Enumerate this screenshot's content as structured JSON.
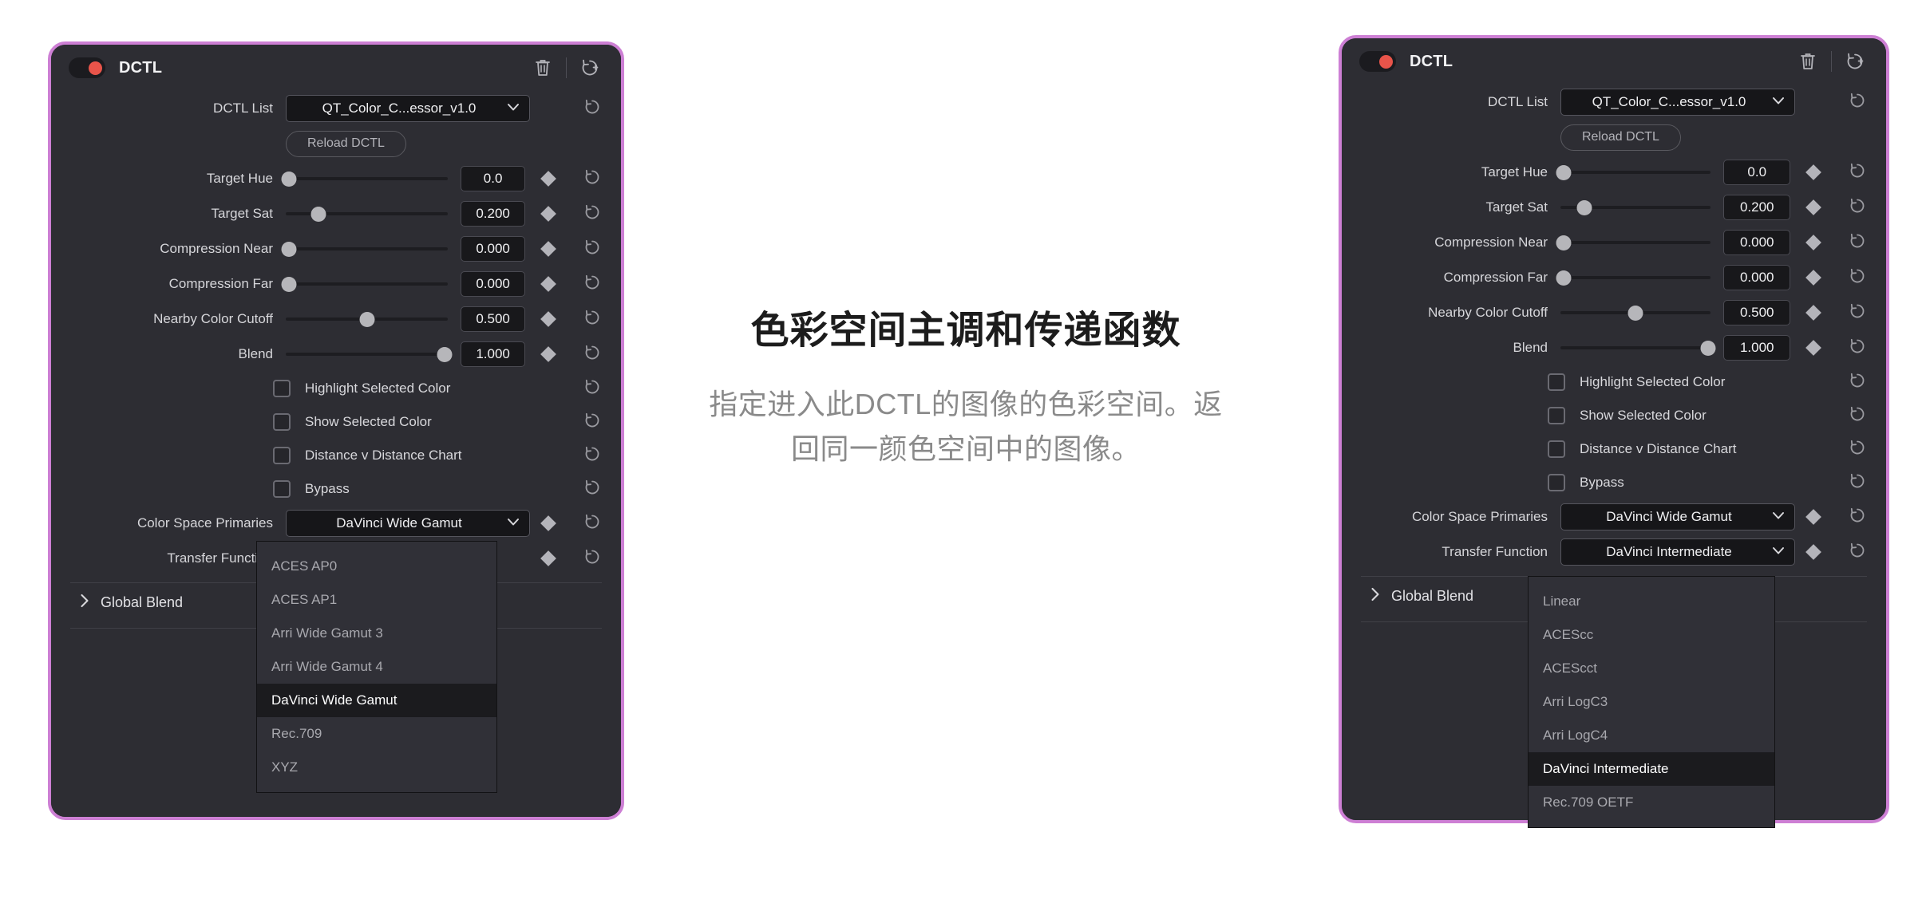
{
  "colors": {
    "panel_border": "#cd7fd4",
    "panel_bg": "#2d2d33",
    "toggle_dot": "#e8544a",
    "menu_bg": "#303037",
    "menu_selected_bg": "#1b1b1e",
    "value_bg": "#18181b",
    "title_text": "#1c1c1c",
    "desc_text": "#8a8a8a"
  },
  "center": {
    "title": "色彩空间主调和传递函数",
    "description": "指定进入此DCTL的图像的色彩空间。返回同一颜色空间中的图像。"
  },
  "panel_left": {
    "header": {
      "title": "DCTL",
      "toggle_state": "on",
      "delete_icon": "trash-icon",
      "reset_all_icon": "reset-add-icon"
    },
    "dctl_list": {
      "label": "DCTL List",
      "value": "QT_Color_C...essor_v1.0",
      "caret_icon": "chevron-down-icon",
      "reset_icon": "reset-icon"
    },
    "reload_button": "Reload DCTL",
    "sliders": [
      {
        "label": "Target Hue",
        "value": "0.0",
        "pos": 2,
        "kf": true,
        "reset_icon": "reset-icon"
      },
      {
        "label": "Target Sat",
        "value": "0.200",
        "pos": 20,
        "kf": true,
        "reset_icon": "reset-icon"
      },
      {
        "label": "Compression Near",
        "value": "0.000",
        "pos": 2,
        "kf": true,
        "reset_icon": "reset-icon"
      },
      {
        "label": "Compression Far",
        "value": "0.000",
        "pos": 2,
        "kf": true,
        "reset_icon": "reset-icon"
      },
      {
        "label": "Nearby Color Cutoff",
        "value": "0.500",
        "pos": 50,
        "kf": true,
        "reset_icon": "reset-icon"
      },
      {
        "label": "Blend",
        "value": "1.000",
        "pos": 98,
        "kf": true,
        "reset_icon": "reset-icon"
      }
    ],
    "checkboxes": [
      {
        "label": "Highlight Selected Color",
        "checked": false,
        "reset_icon": "reset-icon"
      },
      {
        "label": "Show Selected Color",
        "checked": false,
        "reset_icon": "reset-icon"
      },
      {
        "label": "Distance v Distance Chart",
        "checked": false,
        "reset_icon": "reset-icon"
      },
      {
        "label": "Bypass",
        "checked": false,
        "reset_icon": "reset-icon"
      }
    ],
    "color_space_primaries": {
      "label": "Color Space Primaries",
      "value": "DaVinci Wide Gamut",
      "caret_icon": "chevron-down-icon",
      "kf": true,
      "reset_icon": "reset-icon"
    },
    "transfer_function": {
      "label": "Transfer Function",
      "value": "",
      "kf": true,
      "reset_icon": "reset-icon"
    },
    "global_blend": {
      "label": "Global Blend",
      "arrow_icon": "chevron-right-icon"
    },
    "open_menu": {
      "name": "color-space-primaries-menu",
      "items": [
        {
          "label": "ACES AP0",
          "selected": false
        },
        {
          "label": "ACES AP1",
          "selected": false
        },
        {
          "label": "Arri Wide Gamut 3",
          "selected": false
        },
        {
          "label": "Arri Wide Gamut 4",
          "selected": false
        },
        {
          "label": "DaVinci Wide Gamut",
          "selected": true
        },
        {
          "label": "Rec.709",
          "selected": false
        },
        {
          "label": "XYZ",
          "selected": false
        }
      ]
    }
  },
  "panel_right": {
    "header": {
      "title": "DCTL",
      "toggle_state": "on",
      "delete_icon": "trash-icon",
      "reset_all_icon": "reset-add-icon"
    },
    "dctl_list": {
      "label": "DCTL List",
      "value": "QT_Color_C...essor_v1.0",
      "caret_icon": "chevron-down-icon",
      "reset_icon": "reset-icon"
    },
    "reload_button": "Reload DCTL",
    "sliders": [
      {
        "label": "Target Hue",
        "value": "0.0",
        "pos": 2,
        "kf": true,
        "reset_icon": "reset-icon"
      },
      {
        "label": "Target Sat",
        "value": "0.200",
        "pos": 16,
        "kf": true,
        "reset_icon": "reset-icon"
      },
      {
        "label": "Compression Near",
        "value": "0.000",
        "pos": 2,
        "kf": true,
        "reset_icon": "reset-icon"
      },
      {
        "label": "Compression Far",
        "value": "0.000",
        "pos": 2,
        "kf": true,
        "reset_icon": "reset-icon"
      },
      {
        "label": "Nearby Color Cutoff",
        "value": "0.500",
        "pos": 50,
        "kf": true,
        "reset_icon": "reset-icon"
      },
      {
        "label": "Blend",
        "value": "1.000",
        "pos": 98,
        "kf": true,
        "reset_icon": "reset-icon"
      }
    ],
    "checkboxes": [
      {
        "label": "Highlight Selected Color",
        "checked": false,
        "reset_icon": "reset-icon"
      },
      {
        "label": "Show Selected Color",
        "checked": false,
        "reset_icon": "reset-icon"
      },
      {
        "label": "Distance v Distance Chart",
        "checked": false,
        "reset_icon": "reset-icon"
      },
      {
        "label": "Bypass",
        "checked": false,
        "reset_icon": "reset-icon"
      }
    ],
    "color_space_primaries": {
      "label": "Color Space Primaries",
      "value": "DaVinci Wide Gamut",
      "caret_icon": "chevron-down-icon",
      "kf": true,
      "reset_icon": "reset-icon"
    },
    "transfer_function": {
      "label": "Transfer Function",
      "value": "DaVinci Intermediate",
      "caret_icon": "chevron-down-icon",
      "kf": true,
      "reset_icon": "reset-icon"
    },
    "global_blend": {
      "label": "Global Blend",
      "arrow_icon": "chevron-right-icon"
    },
    "open_menu": {
      "name": "transfer-function-menu",
      "items": [
        {
          "label": "Linear",
          "selected": false
        },
        {
          "label": "ACEScc",
          "selected": false
        },
        {
          "label": "ACEScct",
          "selected": false
        },
        {
          "label": "Arri LogC3",
          "selected": false
        },
        {
          "label": "Arri LogC4",
          "selected": false
        },
        {
          "label": "DaVinci Intermediate",
          "selected": true
        },
        {
          "label": "Rec.709 OETF",
          "selected": false
        }
      ]
    }
  }
}
